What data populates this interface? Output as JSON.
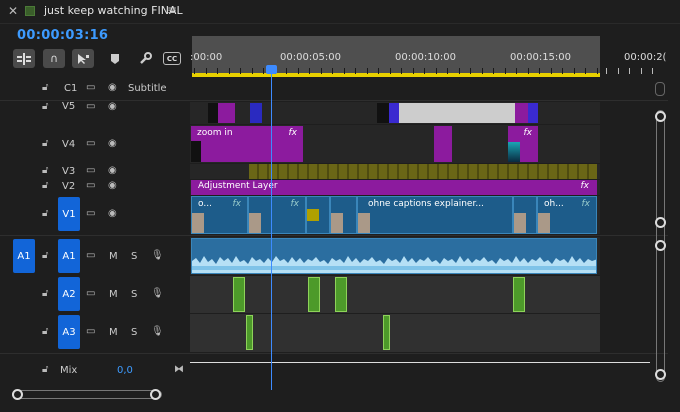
{
  "tab": {
    "close": "✕",
    "title": "just keep watching FINAL",
    "menu": "≡"
  },
  "timecode": "00:00:03:16",
  "toolbar": {
    "snap_label": "∩",
    "cc_label": "CC"
  },
  "ruler": {
    "labels": [
      ":00:00",
      "00:00:05:00",
      "00:00:10:00",
      "00:00:15:00",
      "00:00:2("
    ]
  },
  "tracks": {
    "c1": {
      "name": "C1",
      "label": "Subtitle"
    },
    "v5": {
      "name": "V5"
    },
    "v4": {
      "name": "V4"
    },
    "v3": {
      "name": "V3"
    },
    "v2": {
      "name": "V2"
    },
    "v1": {
      "name": "V1"
    },
    "a1": {
      "source": "A1",
      "name": "A1",
      "m": "M",
      "s": "S"
    },
    "a2": {
      "name": "A2",
      "m": "M",
      "s": "S"
    },
    "a3": {
      "name": "A3",
      "m": "M",
      "s": "S"
    },
    "mix": {
      "label": "Mix",
      "value": "0,0"
    }
  },
  "clips": {
    "zoom_in": "zoom in",
    "fx": "fx",
    "adjustment_layer": "Adjustment Layer",
    "v1_o1": "o...",
    "v1_captions": "ohne captions explainer...",
    "v1_oh": "oh..."
  },
  "colors": {
    "accent": "#3d9bff",
    "target": "#1265d8",
    "video_clip": "#1d5c8a",
    "adjustment": "#8c1b9e",
    "audio_clip": "#4d9a2a",
    "ruler_bar": "#e8d000"
  }
}
